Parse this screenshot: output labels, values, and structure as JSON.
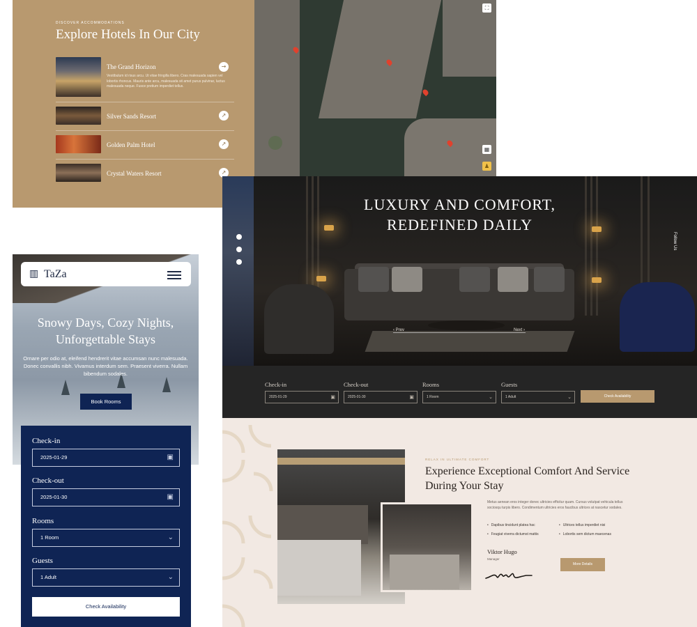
{
  "explore": {
    "eyebrow": "DISCOVER ACCOMMODATIONS",
    "title": "Explore Hotels In Our City",
    "hotels": [
      {
        "name": "The Grand Horizon",
        "description": "Vestibulum id risus arcu. Ut vitae fringilla libero. Cras malesuada sapien vel lobortis rhoncus. Mauris ante arcu, malesuada sit amet purus pulvinar, luctus malesuada neque. Fusce pretium imperdiet tellus.",
        "arrow_icon": "arrow-right-icon"
      },
      {
        "name": "Silver Sands Resort",
        "arrow_icon": "arrow-up-right-icon"
      },
      {
        "name": "Golden Palm Hotel",
        "arrow_icon": "arrow-up-right-icon"
      },
      {
        "name": "Crystal Waters Resort",
        "arrow_icon": "arrow-up-right-icon"
      }
    ],
    "map_controls": [
      "fullscreen-icon",
      "map-layers-icon",
      "street-view-icon"
    ],
    "pin_color": "#e0412d",
    "accent": "#b8996f"
  },
  "hero": {
    "title_line1": "LUXURY AND COMFORT,",
    "title_line2": "REDEFINED DAILY",
    "prev": "Prev",
    "next": "Next",
    "vertical_label": "Follow Us",
    "social_icons": [
      "facebook-icon",
      "twitter-icon",
      "instagram-icon"
    ]
  },
  "booking": {
    "checkin_label": "Check-in",
    "checkin_value": "2025-01-29",
    "checkout_label": "Check-out",
    "checkout_value": "2025-01-30",
    "rooms_label": "Rooms",
    "rooms_value": "1 Room",
    "guests_label": "Guests",
    "guests_value": "1 Adult",
    "button": "Check Availability"
  },
  "about": {
    "eyebrow": "RELAX IN ULTIMATE COMFORT",
    "title": "Experience Exceptional Comfort And Service During Your Stay",
    "body": "Metus aenean eros integer donec ultricies efficitur quam. Cursus volutpat vehicula tellus sociosqu turpis libero. Condimentum ultricies eros faucibus ultrices at nascetur sodales.",
    "bullets": [
      "Dapibus tincidunt platea hac",
      "Ultrices tellus imperdiet nisi",
      "Feugiat viverra dictumst mattis",
      "Lobortis sem dictum maecenas"
    ],
    "manager_name": "Viktor Hugo",
    "manager_role": "Manager",
    "button": "More Details"
  },
  "mobile": {
    "logo": "TaZa",
    "title_line1": "Snowy Days, Cozy Nights,",
    "title_line2": "Unforgettable Stays",
    "body": "Ornare per odio at, eleifend hendrerit vitae accumsan nunc malesuada. Donec convallis nibh. Vivamus interdum sem. Praesent viverra. Nullam bibendum sodales.",
    "cta": "Book Rooms",
    "checkin_label": "Check-in",
    "checkin_value": "2025-01-29",
    "checkout_label": "Check-out",
    "checkout_value": "2025-01-30",
    "rooms_label": "Rooms",
    "rooms_value": "1 Room",
    "guests_label": "Guests",
    "guests_value": "1 Adult",
    "submit": "Check Availability",
    "brand_color": "#0f2454"
  }
}
